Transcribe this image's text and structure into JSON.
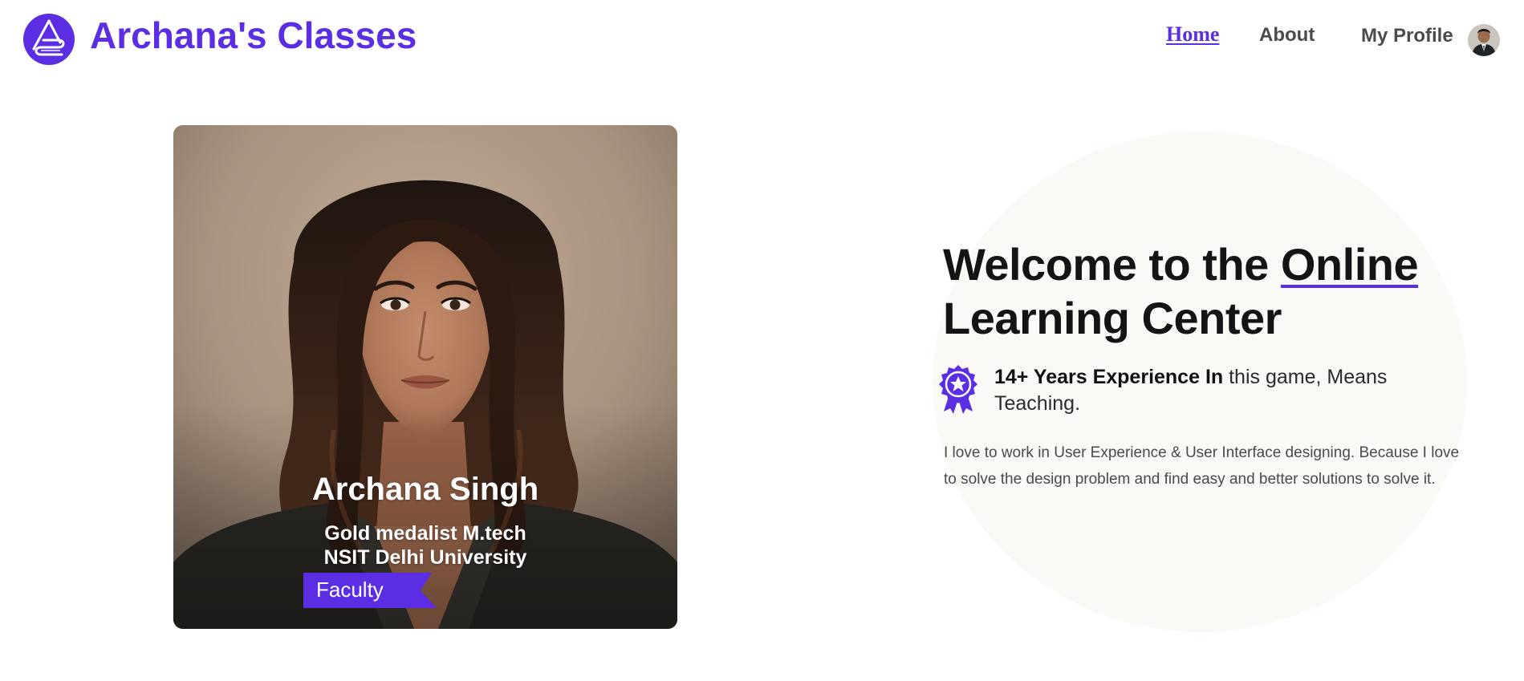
{
  "header": {
    "brand": "Archana's Classes",
    "nav": {
      "home": "Home",
      "about": "About",
      "profile": "My Profile"
    }
  },
  "card": {
    "name": "Archana Singh",
    "degree_line1": "Gold medalist M.tech",
    "degree_line2": "NSIT Delhi University",
    "tag": "Faculty"
  },
  "hero": {
    "title_part1": "Welcome to the ",
    "title_highlight": "Online",
    "title_line2": "Learning Center",
    "experience_bold": "14+ Years Experience In",
    "experience_rest": " this game, Means Teaching.",
    "description": "I love to work in User Experience & User Interface designing. Because I love to solve the design problem and find easy and better solutions to solve it."
  },
  "icons": {
    "logo": "logo-icon",
    "avatar": "avatar",
    "badge": "award-ribbon-icon"
  },
  "colors": {
    "accent": "#5b2ee4",
    "nav_text": "#4b4b4b",
    "title_text": "#141414",
    "circle_bg": "#fbf9f6"
  }
}
